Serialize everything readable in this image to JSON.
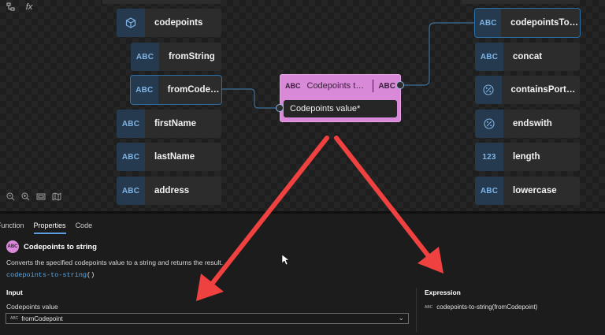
{
  "top_tools": {
    "tree_icon": "tree-icon",
    "fx_label": "fx"
  },
  "left_nodes": [
    {
      "type": "cube-icon",
      "label": "codepoints"
    },
    {
      "type": "ABC",
      "label": "fromString"
    },
    {
      "type": "ABC",
      "label": "fromCodep..."
    },
    {
      "type": "ABC",
      "label": "firstName"
    },
    {
      "type": "ABC",
      "label": "lastName"
    },
    {
      "type": "ABC",
      "label": "address"
    }
  ],
  "right_nodes": [
    {
      "type": "ABC",
      "label": "codepointsToSt..."
    },
    {
      "type": "ABC",
      "label": "concat"
    },
    {
      "type": "percent-icon",
      "label": "containsPortugal"
    },
    {
      "type": "percent-icon",
      "label": "endswith"
    },
    {
      "type": "123",
      "label": "length"
    },
    {
      "type": "ABC",
      "label": "lowercase"
    }
  ],
  "function_node": {
    "icon_text": "ABC",
    "title": "Codepoints to ...",
    "output_type": "ABC",
    "input_label": "Codepoints value*"
  },
  "panel": {
    "tabs": [
      "Function",
      "Properties",
      "Code"
    ],
    "active_tab": "Properties",
    "function_icon_text": "ABC",
    "function_title": "Codepoints to string",
    "description": "Converts the specified codepoints value to a string and returns the result.",
    "signature_name": "codepoints-to-string",
    "signature_parens": "()",
    "input_section": "Input",
    "input_field_label": "Codepoints value",
    "input_value_icon": "ABC",
    "input_value": "fromCodepoint",
    "expression_section": "Expression",
    "expression_icon": "ABC",
    "expression_value": "codepoints-to-string(fromCodepoint)"
  },
  "colors": {
    "function_node": "#d88ad8",
    "node_icon_bg": "#253a4e",
    "connector": "#3d6f99",
    "annotation_arrow": "#f04141",
    "link": "#5aa8e6"
  }
}
